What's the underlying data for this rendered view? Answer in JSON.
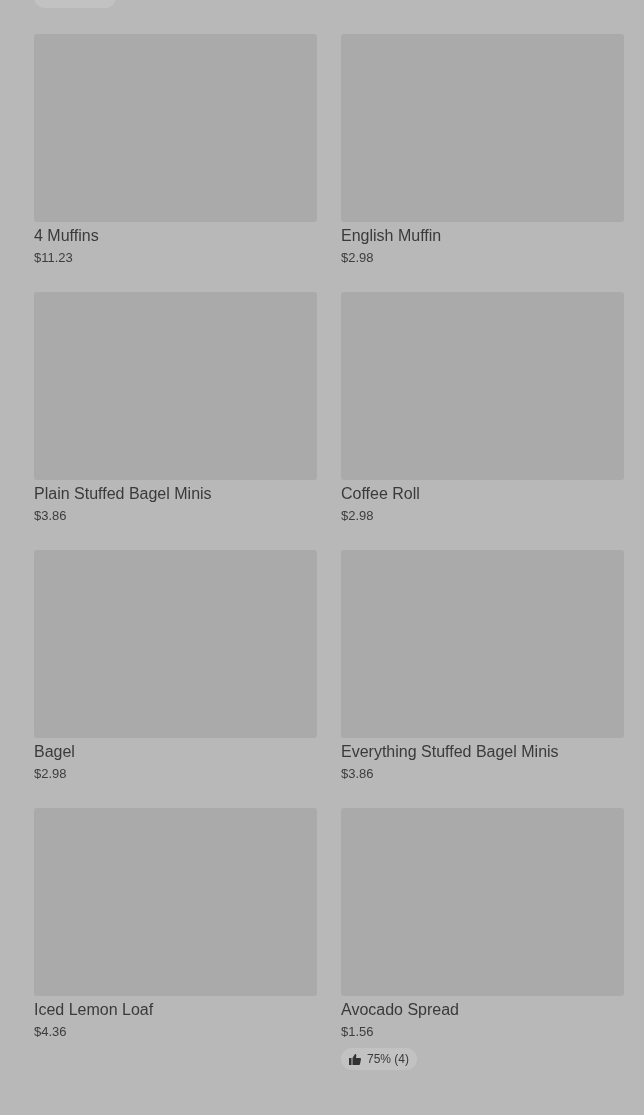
{
  "products": [
    {
      "name": "4 Muffins",
      "price": "$11.23"
    },
    {
      "name": "English Muffin",
      "price": "$2.98"
    },
    {
      "name": "Plain Stuffed Bagel Minis",
      "price": "$3.86"
    },
    {
      "name": "Coffee Roll",
      "price": "$2.98"
    },
    {
      "name": "Bagel",
      "price": "$2.98"
    },
    {
      "name": "Everything Stuffed Bagel Minis",
      "price": "$3.86"
    },
    {
      "name": "Iced Lemon Loaf",
      "price": "$4.36"
    },
    {
      "name": "Avocado Spread",
      "price": "$1.56",
      "rating": "75% (4)"
    }
  ]
}
